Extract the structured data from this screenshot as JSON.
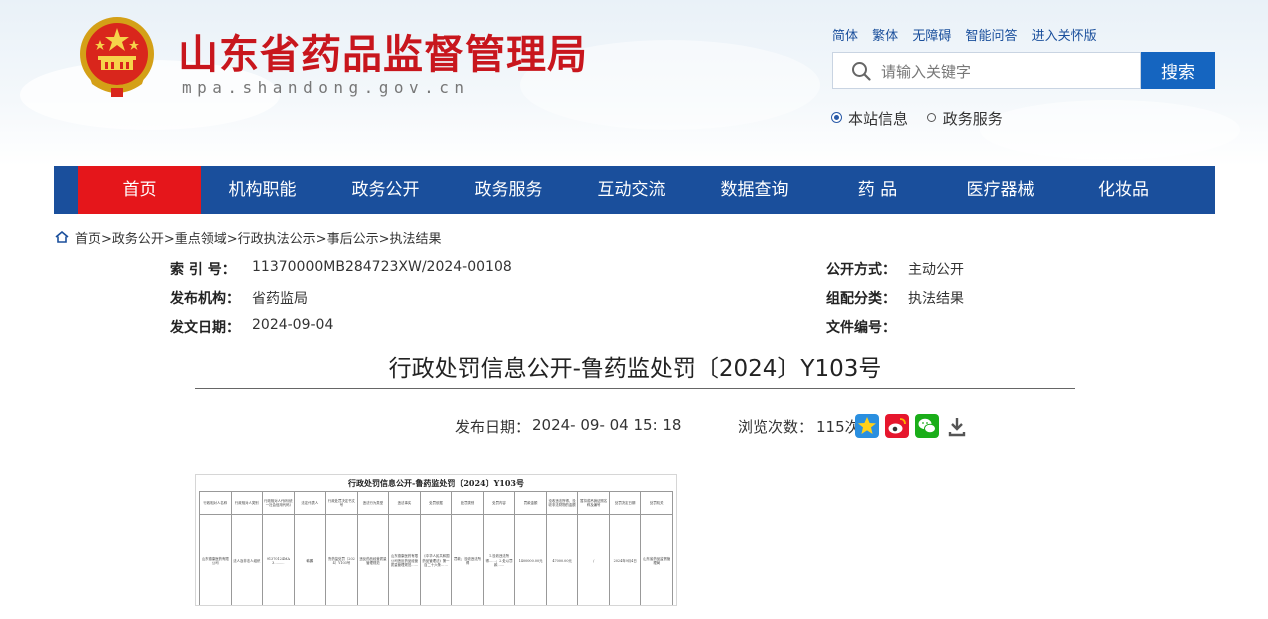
{
  "site": {
    "title": "山东省药品监督管理局",
    "url": "mpa.shandong.gov.cn"
  },
  "toplinks": [
    "简体",
    "繁体",
    "无障碍",
    "智能问答",
    "进入关怀版"
  ],
  "search": {
    "placeholder": "请输入关键字",
    "button_label": "搜索",
    "options": [
      {
        "label": "本站信息",
        "selected": true
      },
      {
        "label": "政务服务",
        "selected": false
      }
    ]
  },
  "nav": {
    "items": [
      "首页",
      "机构职能",
      "政务公开",
      "政务服务",
      "互动交流",
      "数据查询",
      "药 品",
      "医疗器械",
      "化妆品"
    ],
    "active_index": 0,
    "color": "#1a4f9c",
    "active_color": "#e5161b"
  },
  "breadcrumb": "首页>政务公开>重点领域>行政执法公示>事后公示>执法结果",
  "meta": {
    "index_label": "索 引 号：",
    "index_value": "11370000MB284723XW/2024-00108",
    "publisher_label": "发布机构：",
    "publisher_value": "省药监局",
    "date_label": "发文日期：",
    "date_value": "2024-09-04",
    "disclosure_label": "公开方式：",
    "disclosure_value": "主动公开",
    "category_label": "组配分类：",
    "category_value": "执法结果",
    "docno_label": "文件编号：",
    "docno_value": ""
  },
  "article": {
    "title": "行政处罚信息公开-鲁药监处罚〔2024〕Y103号",
    "publish_label": "发布日期：",
    "publish_value": "2024- 09- 04 15: 18",
    "views_label": "浏览次数：",
    "views_value": "115次"
  },
  "share_icons": [
    "qzone-icon",
    "weibo-icon",
    "wechat-icon",
    "download-icon"
  ],
  "document": {
    "title": "行政处罚信息公开-鲁药监处罚〔2024〕Y103号",
    "headers": [
      "行政相对人名称",
      "行政相对人类别",
      "行政相对人代码(统一社会信用代码)",
      "法定代表人",
      "行政处罚决定书文号",
      "违法行为类型",
      "违法事实",
      "处罚依据",
      "处罚类别",
      "处罚内容",
      "罚款金额",
      "没收违法所得、没收非法财物的金额",
      "暂扣或吊销证照名称及编号",
      "处罚决定日期",
      "处罚机关"
    ],
    "row": [
      "山东德康医药有限公司",
      "法人及非法人组织",
      "91370124MA3………",
      "韩鹏",
      "鲁药监处罚〔2024〕Y103号",
      "违反药品经营质量管理规范",
      "山东德康医药有限公司违反药品经营质量管理规范……",
      "《中华人民共和国药品管理法》第一百二十六条……",
      "罚款；没收违法所得",
      "1.没收违法所得……；2.处以罚款……",
      "1400000.00元",
      "47000.00元",
      "/",
      "2024年9月4日",
      "山东省药品监督管理局"
    ]
  }
}
